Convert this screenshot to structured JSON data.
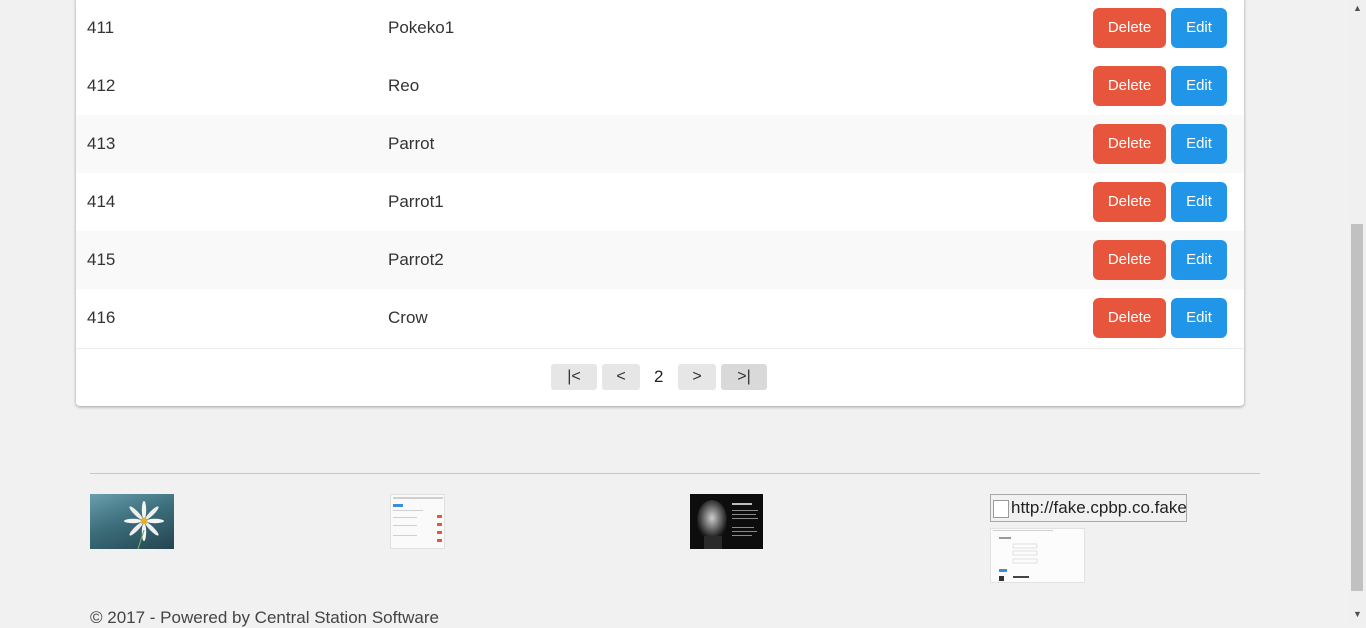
{
  "table": {
    "rows": [
      {
        "id": "411",
        "name": "Pokeko1",
        "delete_label": "Delete",
        "edit_label": "Edit"
      },
      {
        "id": "412",
        "name": "Reo",
        "delete_label": "Delete",
        "edit_label": "Edit"
      },
      {
        "id": "413",
        "name": "Parrot",
        "delete_label": "Delete",
        "edit_label": "Edit"
      },
      {
        "id": "414",
        "name": "Parrot1",
        "delete_label": "Delete",
        "edit_label": "Edit"
      },
      {
        "id": "415",
        "name": "Parrot2",
        "delete_label": "Delete",
        "edit_label": "Edit"
      },
      {
        "id": "416",
        "name": "Crow",
        "delete_label": "Delete",
        "edit_label": "Edit"
      }
    ]
  },
  "pagination": {
    "first_label": "|<",
    "prev_label": "<",
    "current_page": "2",
    "next_label": ">",
    "last_label": ">|"
  },
  "footer": {
    "broken_image_alt": "http://fake.cpbp.co.fake",
    "copyright": "© 2017 - Powered by Central Station Software"
  },
  "colors": {
    "delete": "#e8553d",
    "edit": "#2196e8",
    "background": "#f2f1f1"
  }
}
